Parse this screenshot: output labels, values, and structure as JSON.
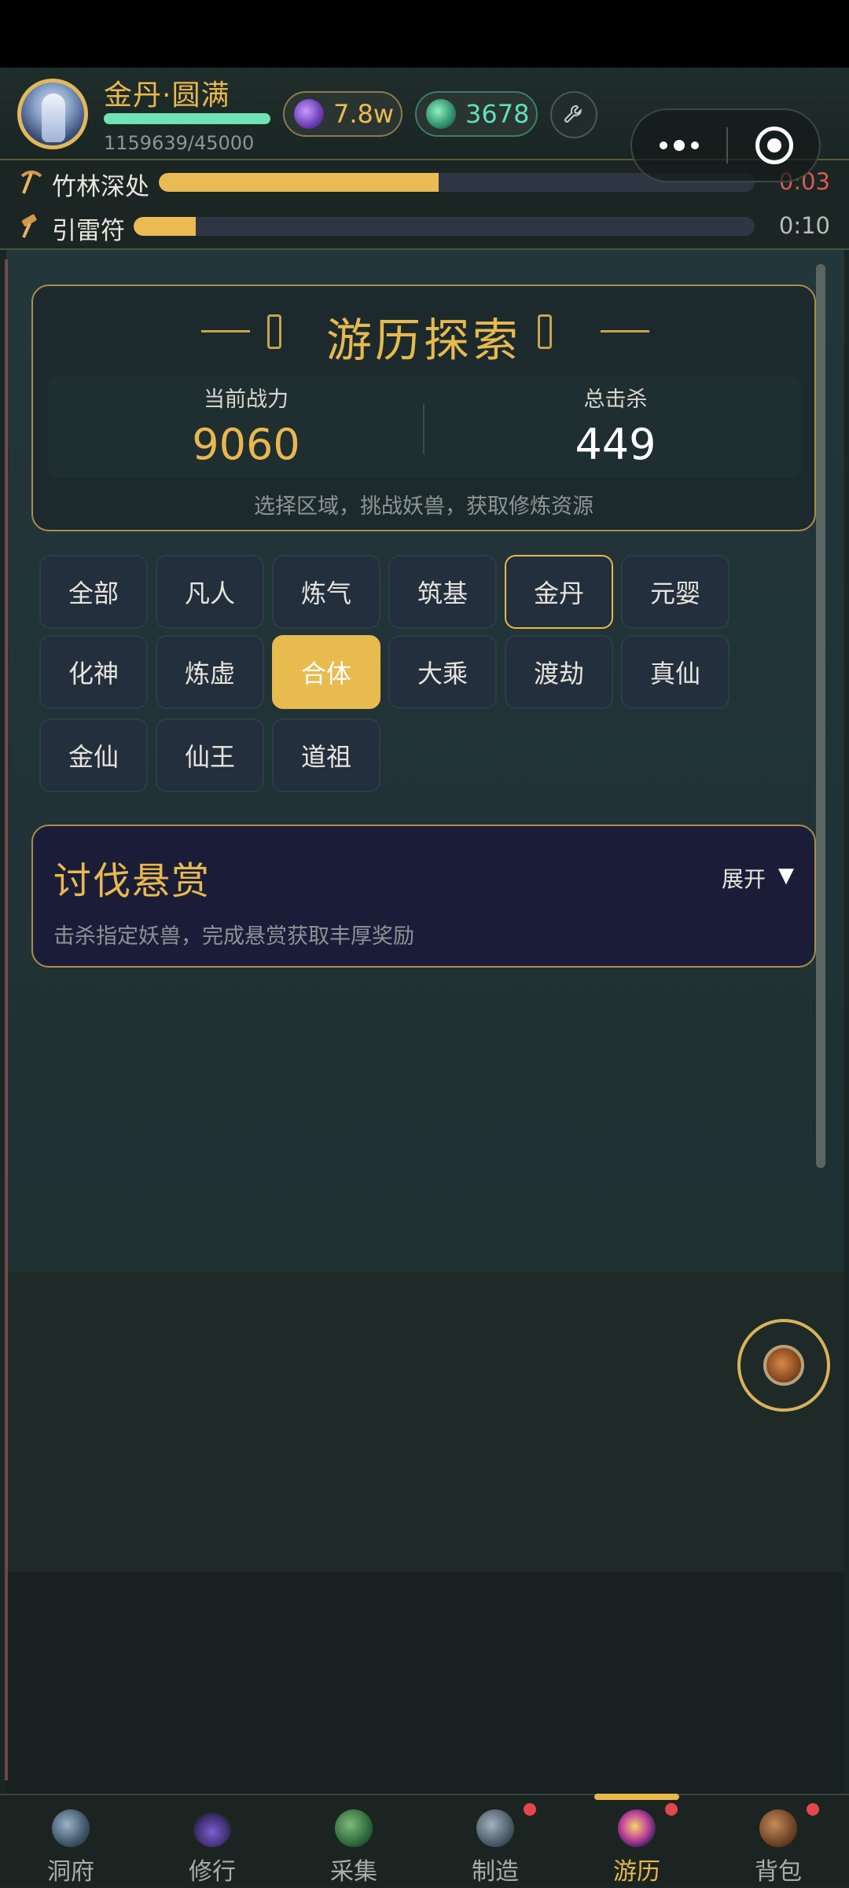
{
  "header": {
    "realm": "金丹·圆满",
    "xp_text": "1159639/45000",
    "xp_progress": 1.0,
    "spirit_value": "7.8w",
    "stone_value": "3678"
  },
  "tasks": [
    {
      "label": "竹林深处",
      "progress": 0.47,
      "time": "0:03",
      "icon": "pickaxe-icon"
    },
    {
      "label": "引雷符",
      "progress": 0.1,
      "time": "0:10",
      "icon": "hammer-icon"
    }
  ],
  "explore": {
    "title": "游历探索",
    "power_label": "当前战力",
    "power_value": "9060",
    "kills_label": "总击杀",
    "kills_value": "449",
    "hint": "选择区域，挑战妖兽，获取修炼资源"
  },
  "regions": [
    {
      "label": "全部",
      "state": "normal"
    },
    {
      "label": "凡人",
      "state": "normal"
    },
    {
      "label": "炼气",
      "state": "normal"
    },
    {
      "label": "筑基",
      "state": "normal"
    },
    {
      "label": "金丹",
      "state": "outlined"
    },
    {
      "label": "元婴",
      "state": "normal"
    },
    {
      "label": "化神",
      "state": "normal"
    },
    {
      "label": "炼虚",
      "state": "normal"
    },
    {
      "label": "合体",
      "state": "selected"
    },
    {
      "label": "大乘",
      "state": "normal"
    },
    {
      "label": "渡劫",
      "state": "normal"
    },
    {
      "label": "真仙",
      "state": "normal"
    },
    {
      "label": "金仙",
      "state": "normal"
    },
    {
      "label": "仙王",
      "state": "normal"
    },
    {
      "label": "道祖",
      "state": "normal"
    }
  ],
  "bounty": {
    "title": "讨伐悬赏",
    "toggle": "展开",
    "arrow": "▼",
    "desc": "击杀指定妖兽，完成悬赏获取丰厚奖励"
  },
  "nav": [
    {
      "label": "洞府",
      "icon": "cave-icon",
      "badge": false,
      "active": false
    },
    {
      "label": "修行",
      "icon": "cultivate-icon",
      "badge": false,
      "active": false
    },
    {
      "label": "采集",
      "icon": "gather-icon",
      "badge": false,
      "active": false
    },
    {
      "label": "制造",
      "icon": "craft-icon",
      "badge": true,
      "active": false
    },
    {
      "label": "游历",
      "icon": "travel-icon",
      "badge": true,
      "active": true
    },
    {
      "label": "背包",
      "icon": "bag-icon",
      "badge": true,
      "active": false
    }
  ],
  "colors": {
    "accent_gold": "#e8bb4f",
    "xp_green": "#6fe3b5",
    "timer_red": "#d85a52",
    "badge_red": "#e3474d"
  }
}
